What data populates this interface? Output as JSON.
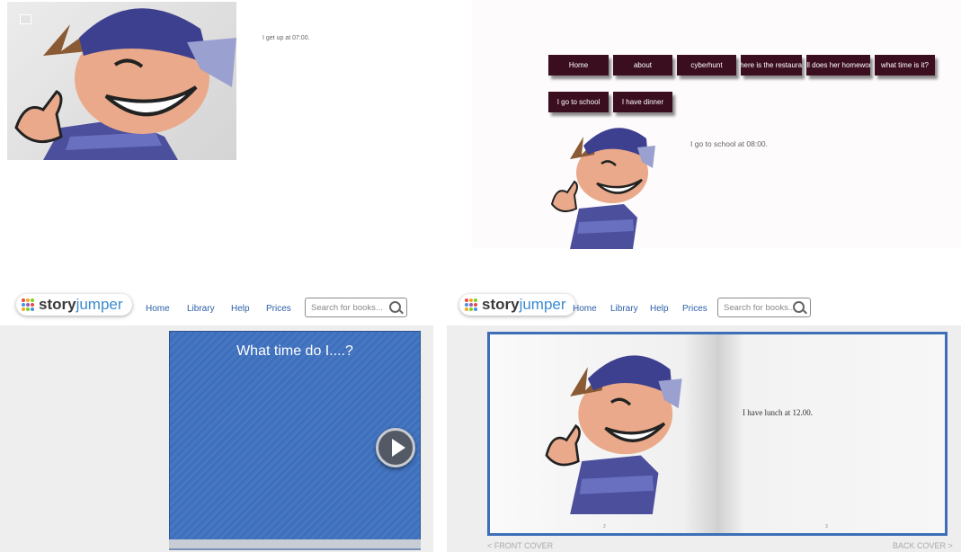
{
  "panel1": {
    "caption": "I get up at 07:00."
  },
  "panel2": {
    "nav": [
      "Home",
      "about",
      "cyberhunt",
      "where is the restaurant",
      "Jill does her homework",
      "what time is it?",
      "I go to school",
      "I have dinner"
    ],
    "caption": "I go to school at 08:00."
  },
  "storyjumper_left": {
    "logo_story": "story",
    "logo_jumper": "jumper",
    "menu": [
      "Home",
      "Library",
      "Help",
      "Prices"
    ],
    "search_placeholder": "Search for books...",
    "book_title": "What time do I....?"
  },
  "storyjumper_right": {
    "logo_story": "story",
    "logo_jumper": "jumper",
    "menu": [
      "Home",
      "Library",
      "Help",
      "Prices"
    ],
    "search_placeholder": "Search for books...",
    "page_text": "I have lunch at 12.00.",
    "left_page_number": "2",
    "right_page_number": "3",
    "front_cover": "< FRONT COVER",
    "back_cover": "BACK COVER >"
  },
  "colors": {
    "nav_button": "#3b0e1f",
    "storyjumper_blue": "#3b8bd0",
    "book_cover": "#4677c3",
    "menu_link": "#2b5fa8"
  },
  "icons": [
    "boy-cartoon-icon",
    "search-icon",
    "play-icon",
    "storyjumper-logo-dots-icon"
  ]
}
